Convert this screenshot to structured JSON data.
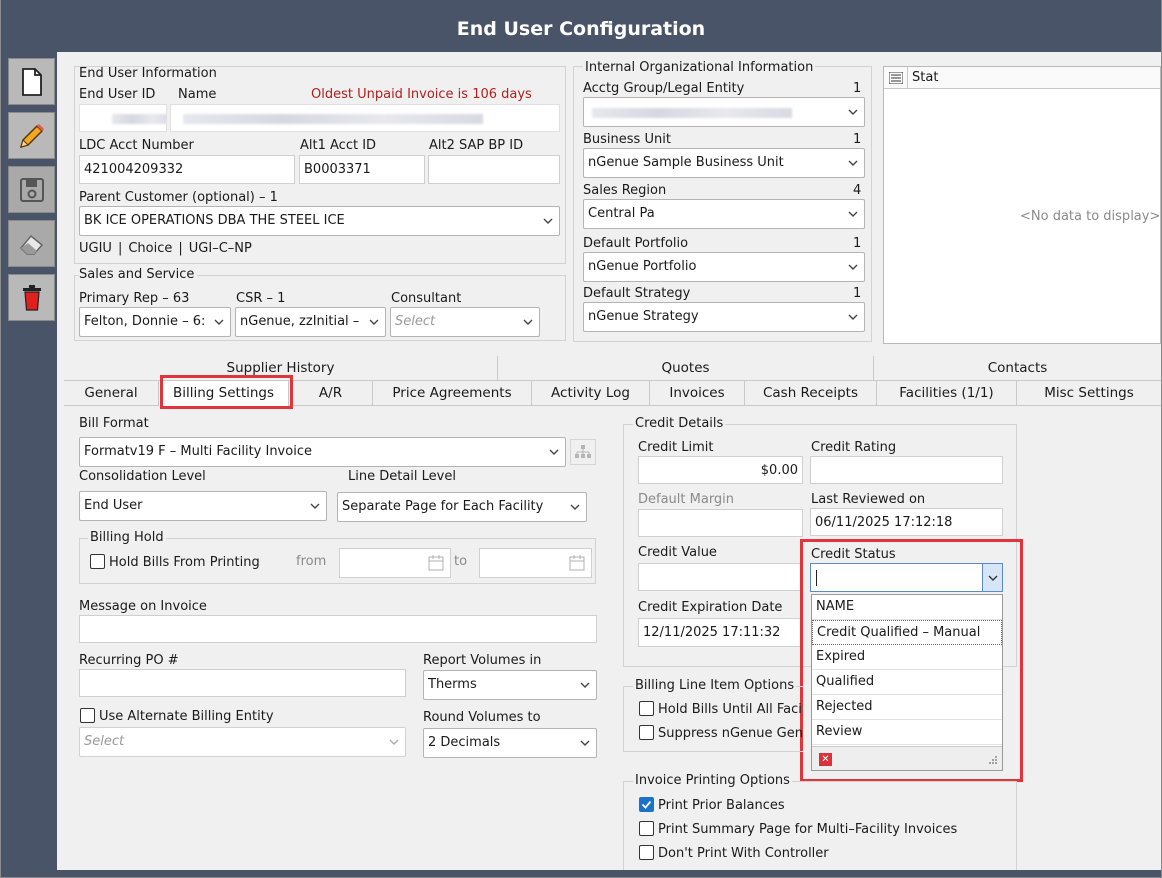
{
  "window": {
    "title": "End User Configuration"
  },
  "toolbar": [
    {
      "icon": "new-document-icon"
    },
    {
      "icon": "pencil-icon"
    },
    {
      "icon": "save-icon"
    },
    {
      "icon": "eraser-icon"
    },
    {
      "icon": "trash-icon"
    }
  ],
  "end_user_info": {
    "section": "End User Information",
    "id_label": "End User ID",
    "name_label": "Name",
    "warning": "Oldest Unpaid Invoice is 106 days",
    "ldc_label": "LDC Acct Number",
    "ldc_value": "421004209332",
    "alt1_label": "Alt1 Acct ID",
    "alt1_value": "B0003371",
    "alt2_label": "Alt2  SAP BP ID",
    "parent_label": "Parent Customer (optional) – 1",
    "parent_value": "BK ICE OPERATIONS DBA THE STEEL ICE",
    "tags": [
      "UGIU",
      "Choice",
      "UGI–C–NP"
    ]
  },
  "sales": {
    "section": "Sales and Service",
    "primary_label": "Primary Rep – 63",
    "primary_value": "Felton, Donnie – 6:",
    "csr_label": "CSR – 1",
    "csr_value": "nGenue, zzInitial –",
    "consultant_label": "Consultant",
    "consultant_placeholder": "Select"
  },
  "org_info": {
    "section": "Internal Organizational Information",
    "fields": [
      {
        "label": "Acctg Group/Legal Entity",
        "count": "1",
        "value": ""
      },
      {
        "label": "Business Unit",
        "count": "1",
        "value": "nGenue Sample Business Unit"
      },
      {
        "label": "Sales Region",
        "count": "4",
        "value": "Central Pa"
      },
      {
        "label": "Default Portfolio",
        "count": "1",
        "value": "nGenue Portfolio"
      },
      {
        "label": "Default Strategy",
        "count": "1",
        "value": "nGenue Strategy"
      }
    ]
  },
  "status_panel": {
    "header": "Stat",
    "empty": "<No data to display>"
  },
  "tabs_top": [
    "Supplier History",
    "Quotes",
    "Contacts"
  ],
  "tabs": [
    "General",
    "Billing Settings",
    "A/R",
    "Price Agreements",
    "Activity Log",
    "Invoices",
    "Cash Receipts",
    "Facilities (1/1)",
    "Misc Settings"
  ],
  "billing": {
    "bill_format_label": "Bill Format",
    "bill_format_value": "Formatv19 F – Multi Facility Invoice",
    "consolidation_label": "Consolidation Level",
    "consolidation_value": "End User",
    "line_detail_label": "Line Detail Level",
    "line_detail_value": "Separate Page for Each Facility",
    "hold_section": "Billing Hold",
    "hold_label": "Hold Bills From Printing",
    "from_label": "from",
    "to_label": "to",
    "message_label": "Message on Invoice",
    "po_label": "Recurring PO #",
    "report_label": "Report Volumes in",
    "report_value": "Therms",
    "alt_entity_label": "Use Alternate Billing Entity",
    "alt_entity_placeholder": "Select",
    "round_label": "Round Volumes to",
    "round_value": "2 Decimals"
  },
  "credit": {
    "section": "Credit Details",
    "limit_label": "Credit Limit",
    "limit_value": "$0.00",
    "rating_label": "Credit Rating",
    "margin_label": "Default Margin",
    "reviewed_label": "Last Reviewed on",
    "reviewed_value": "06/11/2025 17:12:18",
    "value_label": "Credit Value",
    "status_label": "Credit Status",
    "expiration_label": "Credit Expiration Date",
    "expiration_value": "12/11/2025 17:11:32",
    "status_options": [
      "NAME",
      "Credit Qualified – Manual",
      "Expired",
      "Qualified",
      "Rejected",
      "Review"
    ]
  },
  "line_items": {
    "section": "Billing Line Item Options",
    "opt1": "Hold Bills Until All Facili",
    "opt2": "Suppress nGenue Gene"
  },
  "invoice_printing": {
    "section": "Invoice Printing Options",
    "opt1": "Print Prior Balances",
    "opt2": "Print Summary Page for Multi–Facility Invoices",
    "opt3": "Don't Print With Controller"
  },
  "colors": {
    "frame": "#4a5468",
    "warning": "#b0201e",
    "highlight": "#e0353a",
    "check": "#1a73c9"
  }
}
